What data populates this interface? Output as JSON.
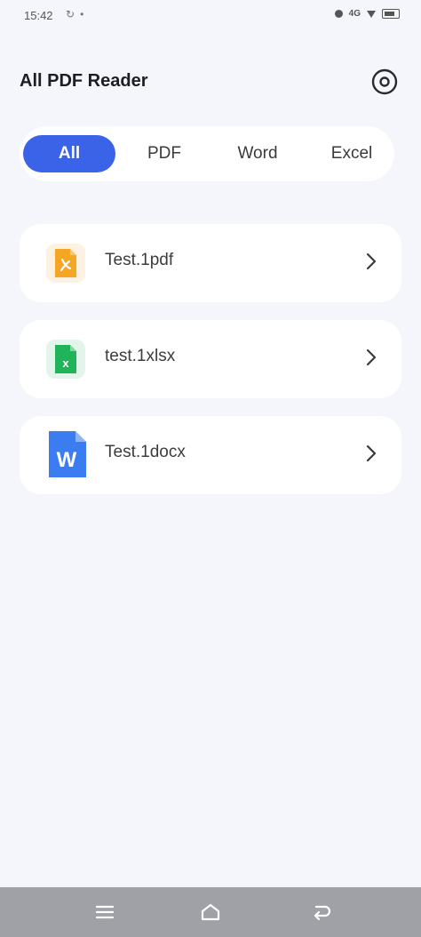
{
  "status_bar": {
    "time": "15:42",
    "left_icons": [
      "sync-icon",
      "location-icon"
    ],
    "right_icons": [
      "vibrate-icon",
      "signal-icon",
      "wifi-icon",
      "battery-icon"
    ],
    "signal_text": "4G"
  },
  "header": {
    "title": "All PDF Reader",
    "settings_icon": "settings-icon"
  },
  "tabs": [
    {
      "label": "All",
      "selected": true
    },
    {
      "label": "PDF",
      "selected": false
    },
    {
      "label": "Word",
      "selected": false
    },
    {
      "label": "Excel",
      "selected": false
    }
  ],
  "files": [
    {
      "name": "Test.1pdf",
      "type": "pdf",
      "icon": "pdf-file-icon",
      "color": "#f5a623",
      "bg": "#fdf1e1"
    },
    {
      "name": "test.1xlsx",
      "type": "excel",
      "icon": "excel-file-icon",
      "color": "#1fb45a",
      "bg": "#e3f5ea"
    },
    {
      "name": "Test.1docx",
      "type": "word",
      "icon": "word-file-icon",
      "color": "#3b7cf0",
      "bg": "#ffffff"
    }
  ],
  "nav": {
    "menu_icon": "menu-icon",
    "home_icon": "home-icon",
    "back_icon": "back-icon"
  },
  "colors": {
    "accent": "#3a63e8",
    "background": "#f4f6fb",
    "card": "#ffffff",
    "nav_bar": "#9fa1a6"
  }
}
